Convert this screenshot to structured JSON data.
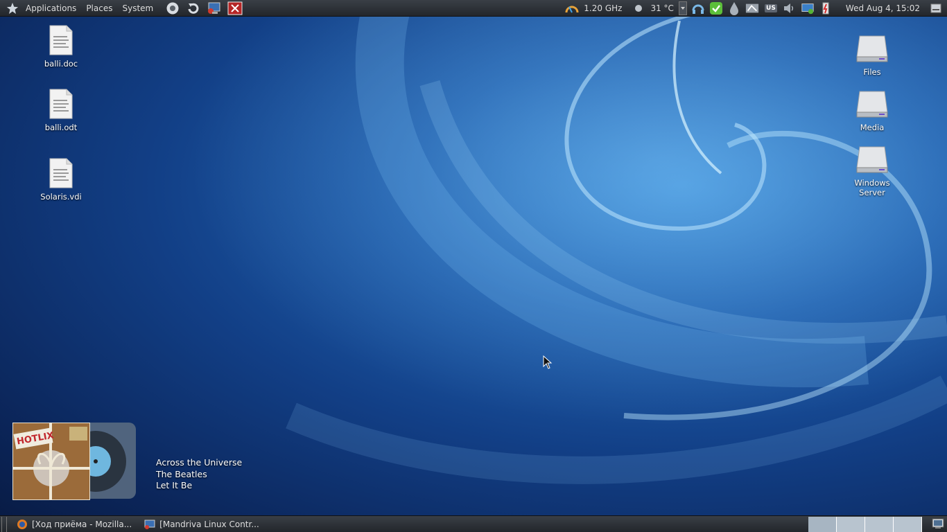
{
  "top_panel": {
    "menus": [
      "Applications",
      "Places",
      "System"
    ],
    "launcher_icons": [
      "firefox-icon",
      "update-icon",
      "network-monitor-icon",
      "close-window-icon"
    ],
    "cpu": "1.20 GHz",
    "temperature": "31 °C",
    "keyboard_layout": "US",
    "clock": "Wed Aug  4, 15:02"
  },
  "desktop_icons_left": [
    {
      "name": "balli.doc"
    },
    {
      "name": "balli.odt"
    },
    {
      "name": "Solaris.vdi"
    }
  ],
  "desktop_icons_right": [
    {
      "name": "Files"
    },
    {
      "name": "Media"
    },
    {
      "name": "Windows Server"
    }
  ],
  "now_playing": {
    "title": "Across the Universe",
    "artist": "The Beatles",
    "album": "Let It Be",
    "album_art_text": "HOTLIX"
  },
  "taskbar": {
    "tasks": [
      {
        "label": "[Ход приёма - Mozilla..."
      },
      {
        "label": "[Mandriva Linux Contr..."
      }
    ]
  },
  "colors": {
    "panel": "#2b2f35",
    "accent": "#3f8fd8"
  }
}
